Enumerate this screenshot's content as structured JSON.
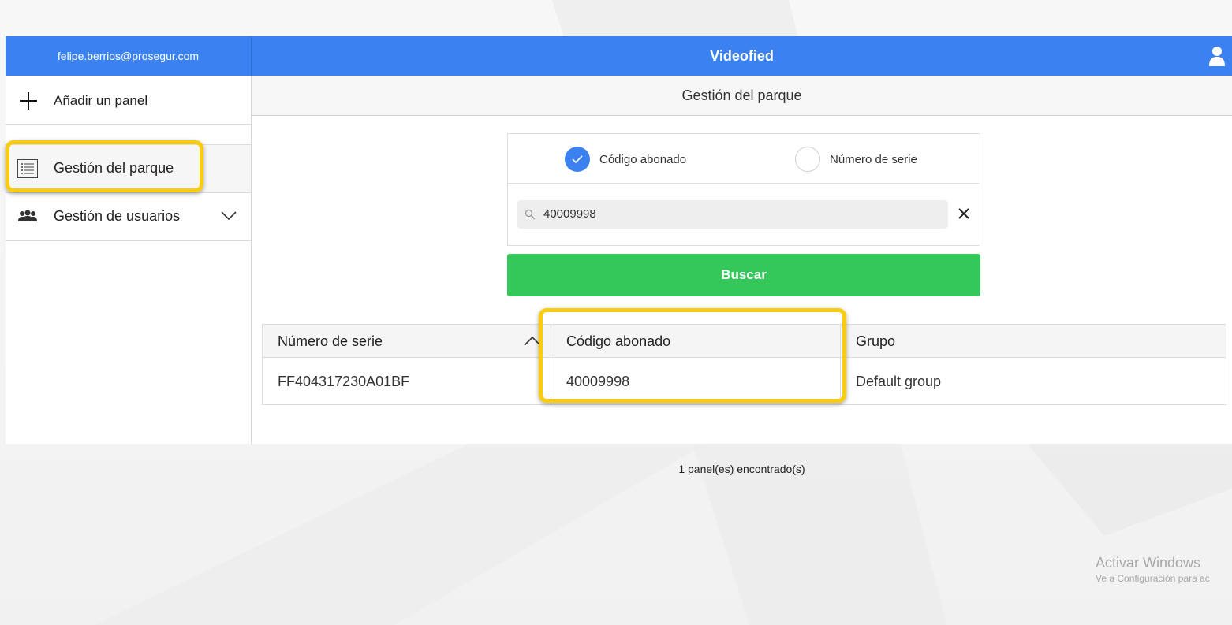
{
  "header": {
    "user_email": "felipe.berrios@prosegur.com",
    "app_title": "Videofied",
    "user_icon": "user-icon"
  },
  "sidebar": {
    "add_panel_label": "Añadir un panel",
    "items": [
      {
        "label": "Gestión del parque",
        "icon": "list-icon"
      },
      {
        "label": "Gestión de usuarios",
        "icon": "users-icon"
      }
    ]
  },
  "main": {
    "title": "Gestión del parque",
    "search": {
      "option_subscriber": "Código abonado",
      "option_serial": "Número de serie",
      "selected": "Código abonado",
      "query": "40009998",
      "button": "Buscar"
    },
    "table": {
      "columns": [
        "Número de serie",
        "Código abonado",
        "Grupo"
      ],
      "rows": [
        [
          "FF404317230A01BF",
          "40009998",
          "Default group"
        ]
      ]
    },
    "result_count": "1 panel(es) encontrado(s)"
  },
  "os_watermark": {
    "title": "Activar Windows",
    "subtitle": "Ve a Configuración para ac"
  },
  "colors": {
    "header": "#3b82f0",
    "button": "#34c85a",
    "highlight": "#f7cc13"
  }
}
